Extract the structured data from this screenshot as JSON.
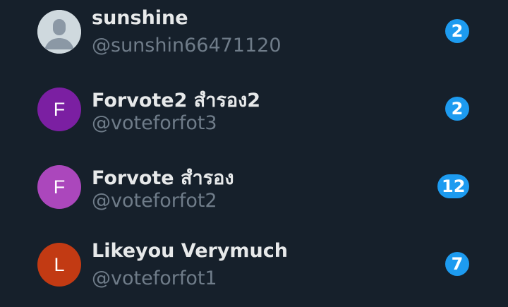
{
  "conversations": [
    {
      "display_name": "sunshine",
      "handle": "@sunshin66471120",
      "unread": "2",
      "avatar": {
        "type": "default-silhouette",
        "color": "#d0d6db"
      }
    },
    {
      "display_name": "Forvote2 สำรอง2",
      "handle": "@voteforfot3",
      "unread": "2",
      "avatar": {
        "type": "initial",
        "initial": "F",
        "color": "#7b1fa2"
      }
    },
    {
      "display_name": "Forvote สำรอง",
      "handle": "@voteforfot2",
      "unread": "12",
      "avatar": {
        "type": "initial",
        "initial": "F",
        "color": "#ab47bc"
      }
    },
    {
      "display_name": "Likeyou Verymuch",
      "handle": "@voteforfot1",
      "unread": "7",
      "avatar": {
        "type": "initial",
        "initial": "L",
        "color": "#c23a13"
      }
    }
  ],
  "colors": {
    "background": "#16202b",
    "name_text": "#e7e9ea",
    "handle_text": "#6f7c89",
    "badge": "#1d9bf0"
  }
}
